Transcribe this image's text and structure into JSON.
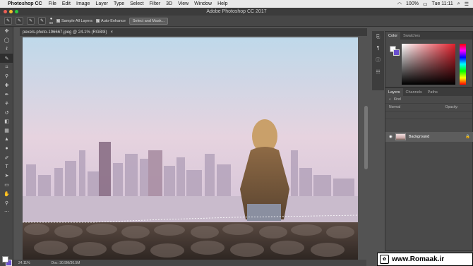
{
  "menubar": {
    "app_name": "Photoshop CC",
    "items": [
      "File",
      "Edit",
      "Image",
      "Layer",
      "Type",
      "Select",
      "Filter",
      "3D",
      "View",
      "Window",
      "Help"
    ],
    "battery": "100%",
    "time": "Tue 11:11"
  },
  "window": {
    "title": "Adobe Photoshop CC 2017"
  },
  "options": {
    "brush_size": "80",
    "sample_all_layers": "Sample All Layers",
    "auto_enhance": "Auto-Enhance",
    "select_and_mask": "Select and Mask..."
  },
  "document": {
    "tab_title": "pexels-photo-196667.jpeg @ 24.1% (RGB/8)",
    "zoom": "24.11%",
    "doc_size": "Doc: 30.5M/30.5M"
  },
  "color_panel": {
    "tabs": [
      "Color",
      "Swatches"
    ]
  },
  "layers_panel": {
    "tabs": [
      "Layers",
      "Channels",
      "Paths"
    ],
    "kind_label": "Kind",
    "blend_mode": "Normal",
    "opacity_label": "Opacity:",
    "layer_name": "Background"
  },
  "watermark": {
    "text": "www.Romaak.ir"
  },
  "colors": {
    "foreground": "#ffffff",
    "background": "#6a4fd0"
  }
}
